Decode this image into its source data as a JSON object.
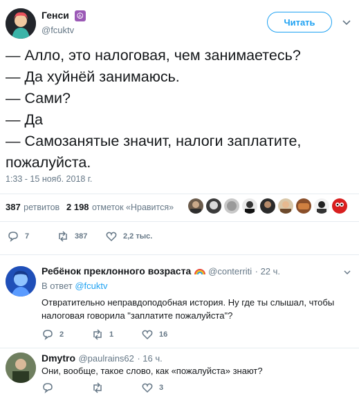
{
  "tweet": {
    "author_name": "Генси",
    "peace_symbol": "☮",
    "author_handle": "@fcuktv",
    "follow_label": "Читать",
    "lines": [
      "— Алло, это налоговая, чем занимаетесь?",
      "— Да хуйнёй занимаюсь.",
      "— Сами?",
      "— Да",
      "— Самозанятые значит, налоги заплатите,",
      "пожалуйста."
    ],
    "timestamp": "1:33 - 15 нояб. 2018 г.",
    "retweets_count": "387",
    "retweets_label": "ретвитов",
    "likes_count": "2 198",
    "likes_label": "отметок «Нравится»",
    "actions": {
      "replies": "7",
      "retweets": "387",
      "likes": "2,2 тыс."
    }
  },
  "replies": [
    {
      "author_name": "Ребёнок преклонного возраста",
      "author_handle": "@conterriti",
      "time": "· 22 ч.",
      "reply_to_prefix": "В ответ",
      "reply_to_handle": "@fcuktv",
      "text_lines": [
        "Отвратительно неправдоподобная история. Ну где ты слышал, чтобы",
        "налоговая говорила \"заплатите пожалуйста\"?"
      ],
      "actions": {
        "replies": "2",
        "retweets": "1",
        "likes": "16"
      }
    },
    {
      "author_name": "Dmytro",
      "author_handle": "@paulrains62",
      "time": "· 16 ч.",
      "text_lines": [
        "Они, вообще, такое слово, как «пожалуйста» знают?"
      ],
      "actions": {
        "likes": "3"
      }
    }
  ],
  "colors": {
    "accent": "#1da1f2",
    "muted": "#657786",
    "divider": "#e6ecf0",
    "text": "#14171a"
  }
}
